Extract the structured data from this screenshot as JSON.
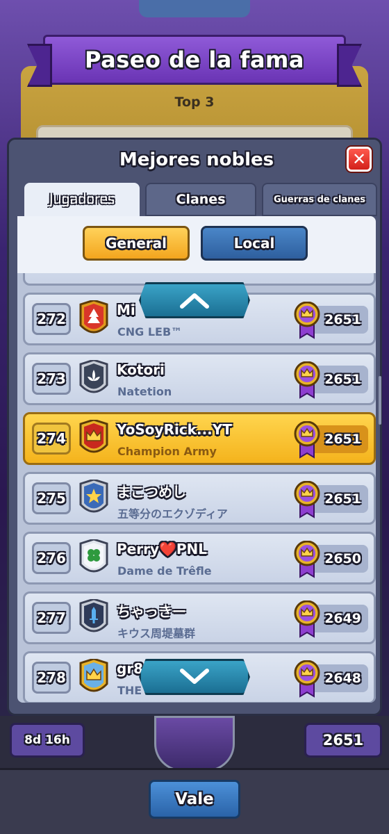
{
  "background": {
    "banner_title": "Paseo de la fama",
    "subtitle": "Top 3",
    "timer": "8d 16h",
    "score": "2651"
  },
  "dialog": {
    "title": "Mejores nobles",
    "close_label": "✕",
    "tabs": [
      {
        "label": "Jugadores",
        "active": true
      },
      {
        "label": "Clanes",
        "active": false
      },
      {
        "label": "Guerras de clanes",
        "active": false
      }
    ],
    "filters": {
      "general_label": "General",
      "local_label": "Local",
      "selected": "General"
    },
    "rows": [
      {
        "rank": "272",
        "name": "Mi",
        "clan": "CNG LEB™",
        "trophies": "2651",
        "badge": "tree",
        "highlight": false
      },
      {
        "rank": "273",
        "name": "Kotori",
        "clan": "Natetion",
        "trophies": "2651",
        "badge": "lotus",
        "highlight": false
      },
      {
        "rank": "274",
        "name": "YoSoyRick...YT",
        "clan": "Champion Army",
        "trophies": "2651",
        "badge": "crown",
        "highlight": true
      },
      {
        "rank": "275",
        "name": "まこつめし",
        "clan": "五等分のエクゾディア",
        "trophies": "2651",
        "badge": "star",
        "highlight": false
      },
      {
        "rank": "276",
        "name": "Perry❤️PNL",
        "clan": "Dame de Trêfle",
        "trophies": "2650",
        "badge": "clover",
        "highlight": false
      },
      {
        "rank": "277",
        "name": "ちゃっきー",
        "clan": "キウス周堤墓群",
        "trophies": "2649",
        "badge": "sword",
        "highlight": false
      },
      {
        "rank": "278",
        "name": "gr8",
        "clan": "THE E",
        "trophies": "2648",
        "badge": "crown-blue",
        "highlight": false
      }
    ]
  },
  "footer": {
    "ok_label": "Vale"
  },
  "colors": {
    "highlight": "#f4b31c",
    "general_button": "#f3a51e",
    "local_button": "#2e5f9e",
    "close_button": "#d2201a"
  }
}
